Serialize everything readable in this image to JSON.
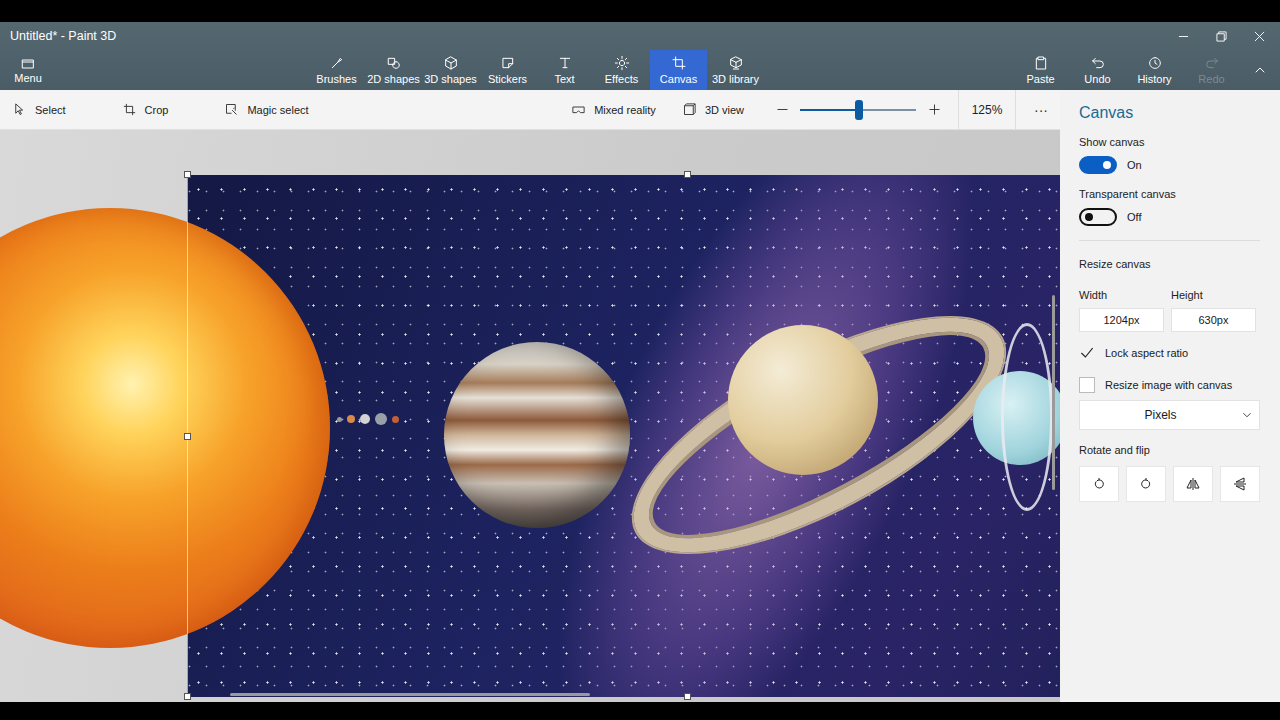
{
  "window": {
    "title": "Untitled* - Paint 3D"
  },
  "menu": {
    "label": "Menu"
  },
  "tools": [
    {
      "label": "Brushes",
      "selected": false
    },
    {
      "label": "2D shapes",
      "selected": false
    },
    {
      "label": "3D shapes",
      "selected": false
    },
    {
      "label": "Stickers",
      "selected": false
    },
    {
      "label": "Text",
      "selected": false
    },
    {
      "label": "Effects",
      "selected": false
    },
    {
      "label": "Canvas",
      "selected": true
    },
    {
      "label": "3D library",
      "selected": false
    }
  ],
  "actions": [
    {
      "label": "Paste",
      "disabled": false
    },
    {
      "label": "Undo",
      "disabled": false
    },
    {
      "label": "History",
      "disabled": false
    },
    {
      "label": "Redo",
      "disabled": true
    }
  ],
  "subtoolbar": {
    "left": [
      {
        "label": "Select"
      },
      {
        "label": "Crop"
      },
      {
        "label": "Magic select"
      }
    ],
    "right": [
      {
        "label": "Mixed reality"
      },
      {
        "label": "3D view"
      }
    ],
    "zoom": {
      "level": 0.51,
      "reading": "125%"
    },
    "more": "···"
  },
  "panel": {
    "title": "Canvas",
    "toggles": [
      {
        "label": "Show canvas",
        "on": true,
        "state": "On"
      },
      {
        "label": "Transparent canvas",
        "on": false,
        "state": "Off"
      }
    ],
    "resize": {
      "title": "Resize canvas",
      "fields": [
        {
          "label": "Width",
          "value": "1204px"
        },
        {
          "label": "Height",
          "value": "630px"
        }
      ],
      "options": [
        {
          "label": "Lock aspect ratio",
          "checked": true
        },
        {
          "label": "Resize image with canvas",
          "checked": false
        }
      ],
      "units": "Pixels"
    },
    "rotate": {
      "title": "Rotate and flip"
    }
  }
}
